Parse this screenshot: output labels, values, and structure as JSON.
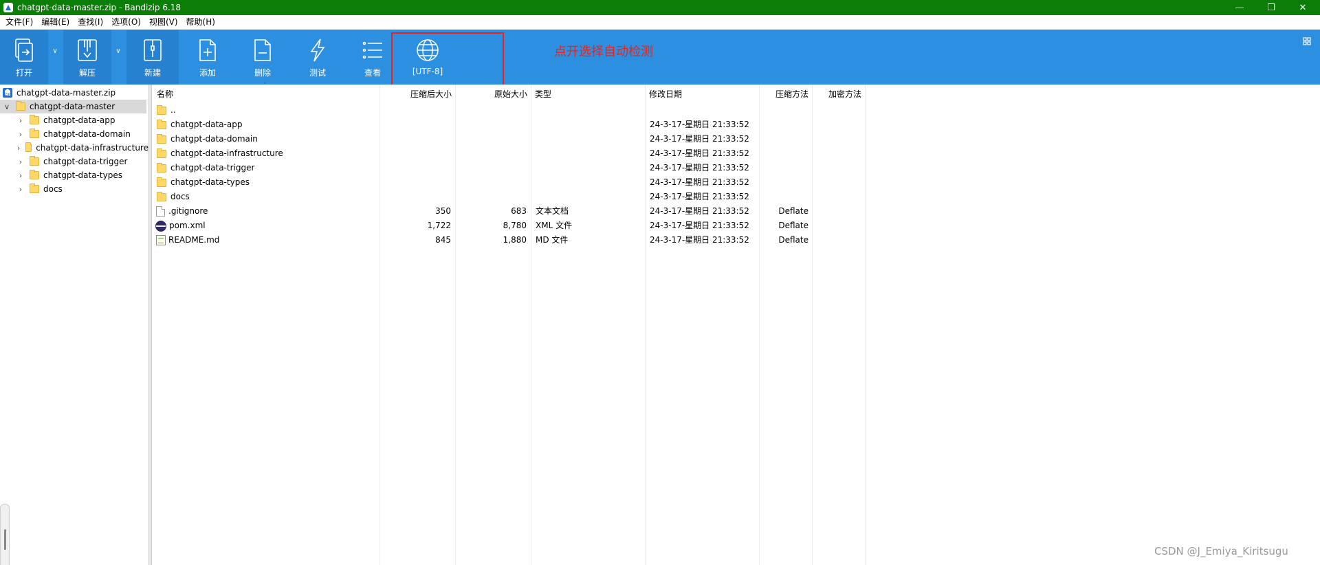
{
  "window": {
    "title": "chatgpt-data-master.zip - Bandizip 6.18",
    "minimize_glyph": "—",
    "maximize_glyph": "❐",
    "close_glyph": "✕"
  },
  "menu": [
    "文件(F)",
    "编辑(E)",
    "查找(I)",
    "选项(O)",
    "视图(V)",
    "帮助(H)"
  ],
  "toolbar": {
    "open_label": "打开",
    "extract_label": "解压",
    "new_label": "新建",
    "add_label": "添加",
    "delete_label": "删除",
    "test_label": "测试",
    "view_label": "查看",
    "codepage_label": "[UTF-8]",
    "dropdown_glyph": "∨"
  },
  "annotation": {
    "text": "点开选择自动检测",
    "color": "#e8231c"
  },
  "tree": {
    "archive": "chatgpt-data-master.zip",
    "root": "chatgpt-data-master",
    "expanded_glyph": "∨",
    "collapsed_glyph": "›",
    "children": [
      "chatgpt-data-app",
      "chatgpt-data-domain",
      "chatgpt-data-infrastructure",
      "chatgpt-data-trigger",
      "chatgpt-data-types",
      "docs"
    ]
  },
  "list": {
    "sort_glyph": "˄",
    "columns": {
      "name": "名称",
      "packed": "压缩后大小",
      "original": "原始大小",
      "type": "类型",
      "modified": "修改日期",
      "method": "压缩方法",
      "encryption": "加密方法"
    },
    "rows": [
      {
        "kind": "folder",
        "name": "..",
        "packed": "",
        "original": "",
        "type": "",
        "modified": "",
        "method": ""
      },
      {
        "kind": "folder",
        "name": "chatgpt-data-app",
        "packed": "",
        "original": "",
        "type": "",
        "modified": "24-3-17-星期日 21:33:52",
        "method": ""
      },
      {
        "kind": "folder",
        "name": "chatgpt-data-domain",
        "packed": "",
        "original": "",
        "type": "",
        "modified": "24-3-17-星期日 21:33:52",
        "method": ""
      },
      {
        "kind": "folder",
        "name": "chatgpt-data-infrastructure",
        "packed": "",
        "original": "",
        "type": "",
        "modified": "24-3-17-星期日 21:33:52",
        "method": ""
      },
      {
        "kind": "folder",
        "name": "chatgpt-data-trigger",
        "packed": "",
        "original": "",
        "type": "",
        "modified": "24-3-17-星期日 21:33:52",
        "method": ""
      },
      {
        "kind": "folder",
        "name": "chatgpt-data-types",
        "packed": "",
        "original": "",
        "type": "",
        "modified": "24-3-17-星期日 21:33:52",
        "method": ""
      },
      {
        "kind": "folder",
        "name": "docs",
        "packed": "",
        "original": "",
        "type": "",
        "modified": "24-3-17-星期日 21:33:52",
        "method": ""
      },
      {
        "kind": "file",
        "name": ".gitignore",
        "packed": "350",
        "original": "683",
        "type": "文本文档",
        "modified": "24-3-17-星期日 21:33:52",
        "method": "Deflate"
      },
      {
        "kind": "pom",
        "name": "pom.xml",
        "packed": "1,722",
        "original": "8,780",
        "type": "XML 文件",
        "modified": "24-3-17-星期日 21:33:52",
        "method": "Deflate"
      },
      {
        "kind": "md",
        "name": "README.md",
        "packed": "845",
        "original": "1,880",
        "type": "MD 文件",
        "modified": "24-3-17-星期日 21:33:52",
        "method": "Deflate"
      }
    ]
  },
  "watermark": "CSDN @J_Emiya_Kiritsugu",
  "colors": {
    "titlebar": "#0a7e07",
    "toolbar": "#2d8fe0",
    "annotation": "#e8231c"
  }
}
